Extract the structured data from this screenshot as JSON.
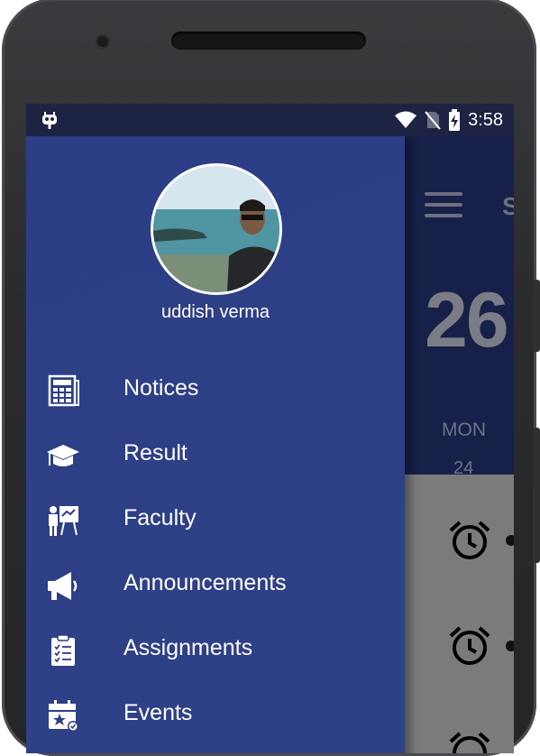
{
  "status_bar": {
    "time": "3:58",
    "left_icon": "robot-notification-icon",
    "right_icons": [
      "wifi-icon",
      "no-sim-icon",
      "battery-charging-icon"
    ]
  },
  "background_app": {
    "title_partial": "S",
    "big_date": "26",
    "day_name": "MON",
    "day_number": "24",
    "header_color": "#172048",
    "body_color": "#7b7b7b",
    "list_icons": [
      "alarm-clock-icon",
      "alarm-clock-icon",
      "alarm-clock-icon"
    ]
  },
  "drawer": {
    "background": "#2d3f85",
    "user": {
      "name": "uddish verma",
      "avatar": "profile-photo"
    },
    "items": [
      {
        "label": "Notices",
        "icon": "notices-icon"
      },
      {
        "label": "Result",
        "icon": "graduation-cap-icon"
      },
      {
        "label": "Faculty",
        "icon": "teacher-board-icon"
      },
      {
        "label": "Announcements",
        "icon": "megaphone-icon"
      },
      {
        "label": "Assignments",
        "icon": "clipboard-checklist-icon"
      },
      {
        "label": "Events",
        "icon": "calendar-star-icon"
      }
    ]
  }
}
